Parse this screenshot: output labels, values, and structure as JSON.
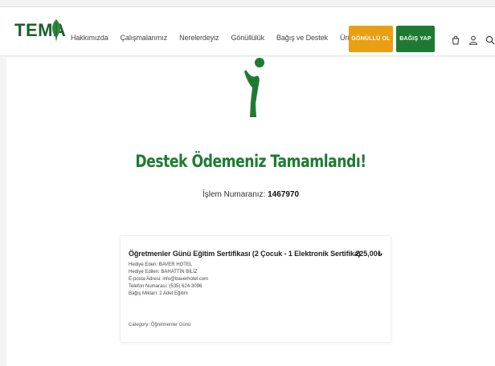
{
  "header": {
    "logo_text": "TEMA",
    "nav": [
      "Hakkımızda",
      "Çalışmalarımız",
      "Nerelerdeyiz",
      "Gönüllülük",
      "Bağış ve Destek",
      "Ürünler"
    ],
    "volunteer_button": "GÖNÜLLÜ OL",
    "donate_button": "BAĞIŞ YAP",
    "icons": [
      "bag-icon",
      "user-icon",
      "search-icon"
    ],
    "colors": {
      "brand_green": "#1e7a33",
      "accent_orange": "#e8a012"
    }
  },
  "main": {
    "title": "Destek Ödemeniz Tamamlandı!",
    "order_label": "İşlem Numaranız:",
    "order_number": "1467970"
  },
  "order": {
    "product_name": "Öğretmenler Günü Eğitim Sertifikası (2 Çocuk - 1 Elektronik Sertifika)",
    "price": "225,00₺",
    "details": [
      "Hediye Eden: BAVER HOTEL",
      "Hediye Edilen: BAHATTİN BİLİZ",
      "E-posta Adresi: info@baverhotel.com",
      "Telefon Numarası: (535) 624-3096",
      "Bağış Miktarı: 2 Adet Eğitim"
    ],
    "category": "Category: Öğretmenler Günü"
  }
}
